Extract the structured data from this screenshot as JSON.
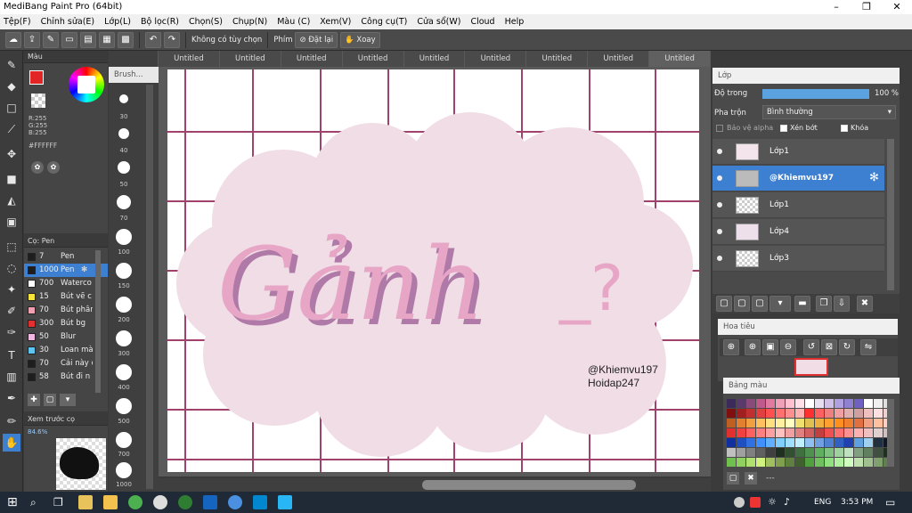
{
  "window": {
    "title": "MediBang Paint Pro (64bit)",
    "minimize": "–",
    "maximize": "❐",
    "close": "✕"
  },
  "menu": [
    "Tệp(F)",
    "Chỉnh sửa(E)",
    "Lớp(L)",
    "Bộ lọc(R)",
    "Chọn(S)",
    "Chụp(N)",
    "Màu (C)",
    "Xem(V)",
    "Công cụ(T)",
    "Cửa sổ(W)",
    "Cloud",
    "Help"
  ],
  "toolbar": {
    "no_option": "Không có tùy chọn",
    "key_label": "Phím",
    "reset_label": "Đặt lại",
    "rotate_label": "Xoay"
  },
  "tabs": [
    "Untitled",
    "Untitled",
    "Untitled",
    "Untitled",
    "Untitled",
    "Untitled",
    "Untitled",
    "Untitled",
    "Untitled"
  ],
  "color_panel": {
    "title": "Màu",
    "r": "R:255",
    "g": "G:255",
    "b": "B:255",
    "hex": "#FFFFFF"
  },
  "brush_panel": {
    "title": "Cọ: Pen",
    "items": [
      {
        "size": "7",
        "name": "Pen",
        "color": "#1e1e1e"
      },
      {
        "size": "1000",
        "name": "Pen",
        "color": "#1e1e1e"
      },
      {
        "size": "700",
        "name": "Waterco",
        "color": "#ffffff"
      },
      {
        "size": "15",
        "name": "Bút vẽ c",
        "color": "#f6e43a"
      },
      {
        "size": "70",
        "name": "Bút phân",
        "color": "#f0a0b0"
      },
      {
        "size": "300",
        "name": "Bút bg",
        "color": "#e03030"
      },
      {
        "size": "50",
        "name": "Blur",
        "color": "#f0b8e0"
      },
      {
        "size": "30",
        "name": "Loan mà",
        "color": "#5dc5f0"
      },
      {
        "size": "70",
        "name": "Cải này c",
        "color": "#1e1e1e"
      },
      {
        "size": "58",
        "name": "Bút đi n",
        "color": "#1e1e1e"
      }
    ]
  },
  "preview_panel": {
    "title": "Xem trước cọ",
    "zoom": "84.6%"
  },
  "size_panel": {
    "title": "Brush...",
    "sizes": [
      "30",
      "40",
      "50",
      "70",
      "100",
      "150",
      "200",
      "300",
      "400",
      "500",
      "700",
      "1000"
    ]
  },
  "canvas": {
    "title_text": "Gảnh",
    "question": "_?",
    "watermark1": "@Khiemvu197",
    "watermark2": "Hoidap247"
  },
  "layer_panel": {
    "title": "Lớp",
    "opacity_label": "Độ trong",
    "opacity_value": "100 %",
    "opacity": 1.0,
    "blend_label": "Pha trộn",
    "blend_value": "Bình thường",
    "protect_alpha": "Bảo vệ alpha",
    "clip": "Xén bớt",
    "lock": "Khóa",
    "layers": [
      {
        "name": "Lớp1"
      },
      {
        "name": "@Khiemvu197"
      },
      {
        "name": "Lớp1"
      },
      {
        "name": "Lớp4"
      },
      {
        "name": "Lớp3"
      }
    ]
  },
  "nav_panel": {
    "title": "Hoa tiêu"
  },
  "palette_panel": {
    "title": "Bảng màu",
    "footer": "---"
  },
  "taskbar": {
    "lang": "ENG",
    "time": "3:53 PM"
  },
  "colors": {
    "accent": "#3d7fd1",
    "pink_dark": "#e7a6c6",
    "pink_cloud": "#f0dde5",
    "grid": "#a1426e"
  }
}
